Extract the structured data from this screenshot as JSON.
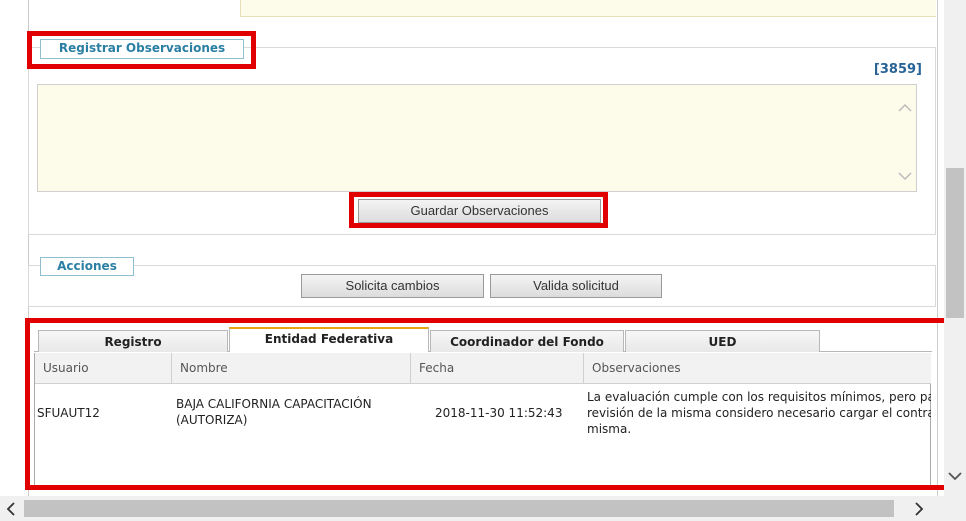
{
  "observaciones": {
    "legend": "Registrar Observaciones",
    "counter": "[3859]",
    "textarea_value": "",
    "save_button": "Guardar Observaciones"
  },
  "acciones": {
    "legend": "Acciones",
    "request_changes_button": "Solicita cambios",
    "validate_button": "Valida solicitud"
  },
  "tabs": [
    {
      "label": "Registro"
    },
    {
      "label": "Entidad Federativa",
      "active": true
    },
    {
      "label": "Coordinador del Fondo"
    },
    {
      "label": "UED"
    }
  ],
  "table": {
    "columns": [
      "Usuario",
      "Nombre",
      "Fecha",
      "Observaciones"
    ],
    "rows": [
      {
        "usuario": "SFUAUT12",
        "nombre_line1": "BAJA CALIFORNIA CAPACITACIÓN",
        "nombre_line2": "(AUTORIZA)",
        "fecha": "2018-11-30 11:52:43",
        "obs_line1": "La evaluación cumple con los requisitos mínimos, pero para h",
        "obs_line2": "revisión de la misma considero necesario cargar el contrato d",
        "obs_line3": "misma."
      }
    ]
  },
  "colors": {
    "highlight": "#e00000",
    "legend_text": "#2a7fa3",
    "counter_text": "#2a6496",
    "active_tab_accent": "#e8a317"
  },
  "icons": {
    "textarea_scroll_up": "chevron-up-icon",
    "textarea_scroll_down": "chevron-down-icon",
    "hscroll_left": "chevron-left-icon",
    "hscroll_right": "chevron-right-icon",
    "vscroll_down": "chevron-down-icon"
  }
}
